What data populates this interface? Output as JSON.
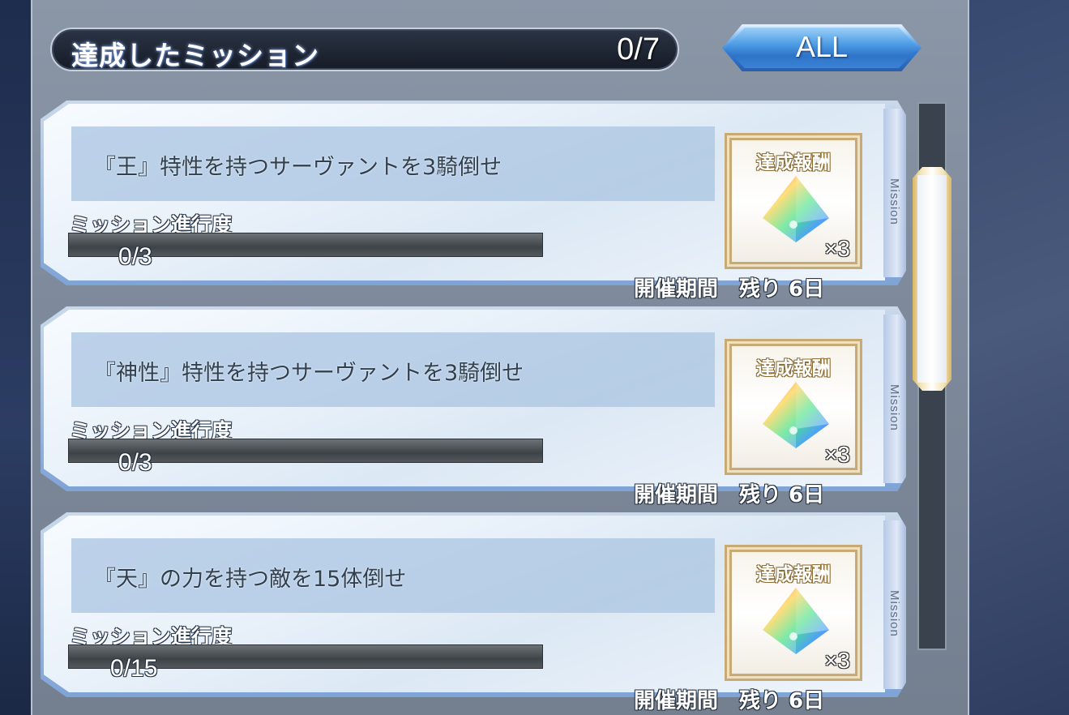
{
  "header": {
    "title": "達成したミッション",
    "count": "0/7",
    "filter_label": "ALL"
  },
  "missions": [
    {
      "text": "『王』特性を持つサーヴァントを3騎倒せ",
      "progress_label": "ミッション進行度",
      "progress_value": "0/3",
      "progress_fraction": 0,
      "reward_title": "達成報酬",
      "reward_icon": "saint-quartz-icon",
      "reward_qty": "×3",
      "period": "開催期間　残り 6日",
      "side_label": "Mission"
    },
    {
      "text": "『神性』特性を持つサーヴァントを3騎倒せ",
      "progress_label": "ミッション進行度",
      "progress_value": "0/3",
      "progress_fraction": 0,
      "reward_title": "達成報酬",
      "reward_icon": "saint-quartz-icon",
      "reward_qty": "×3",
      "period": "開催期間　残り 6日",
      "side_label": "Mission"
    },
    {
      "text": "『天』の力を持つ敵を15体倒せ",
      "progress_label": "ミッション進行度",
      "progress_value": "0/15",
      "progress_fraction": 0,
      "reward_title": "達成報酬",
      "reward_icon": "saint-quartz-icon",
      "reward_qty": "×3",
      "period": "開催期間　残り 6日",
      "side_label": "Mission"
    }
  ],
  "colors": {
    "accent_blue": "#2f7ad0",
    "reward_gold": "#c8aa74",
    "panel_gray": "#7f8b9c"
  }
}
